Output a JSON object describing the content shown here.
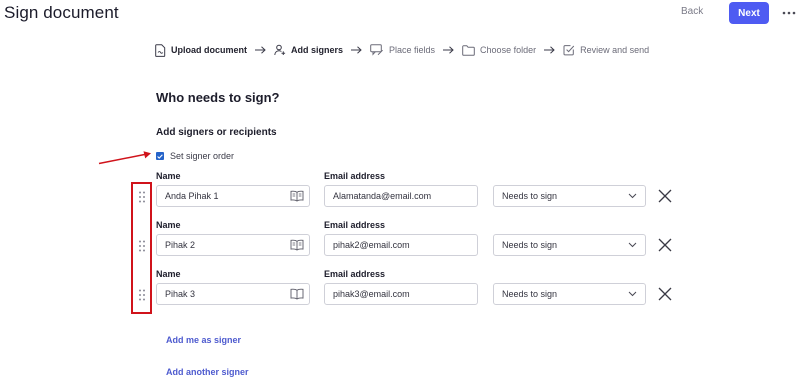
{
  "header": {
    "title": "Sign document",
    "back_label": "Back",
    "next_label": "Next",
    "more_label": "•••"
  },
  "stepper": {
    "steps": [
      {
        "label": "Upload document",
        "icon": "document-icon",
        "active": true
      },
      {
        "label": "Add signers",
        "icon": "user-plus-icon",
        "active": true
      },
      {
        "label": "Place fields",
        "icon": "chat-pen-icon",
        "active": false
      },
      {
        "label": "Choose folder",
        "icon": "folder-icon",
        "active": false
      },
      {
        "label": "Review and send",
        "icon": "check-square-icon",
        "active": false
      }
    ]
  },
  "main": {
    "heading": "Who needs to sign?",
    "subheading": "Add signers or recipients",
    "signer_order_label": "Set signer order",
    "signer_order_checked": true
  },
  "signers": [
    {
      "name_label": "Name",
      "email_label": "Email address",
      "name": "Anda Pihak 1",
      "email": "Alamatanda@email.com",
      "role": "Needs to sign"
    },
    {
      "name_label": "Name",
      "email_label": "Email address",
      "name": "Pihak 2",
      "email": "pihak2@email.com",
      "role": "Needs to sign"
    },
    {
      "name_label": "Name",
      "email_label": "Email address",
      "name": "Pihak 3",
      "email": "pihak3@email.com",
      "role": "Needs to sign"
    }
  ],
  "actions": {
    "add_me_label": "Add me as signer",
    "add_another_label": "Add another signer"
  },
  "colors": {
    "accent": "#4e5bf2",
    "link": "#4e5bcf",
    "annotation_red": "#d0131b",
    "checkbox": "#2563c9"
  }
}
